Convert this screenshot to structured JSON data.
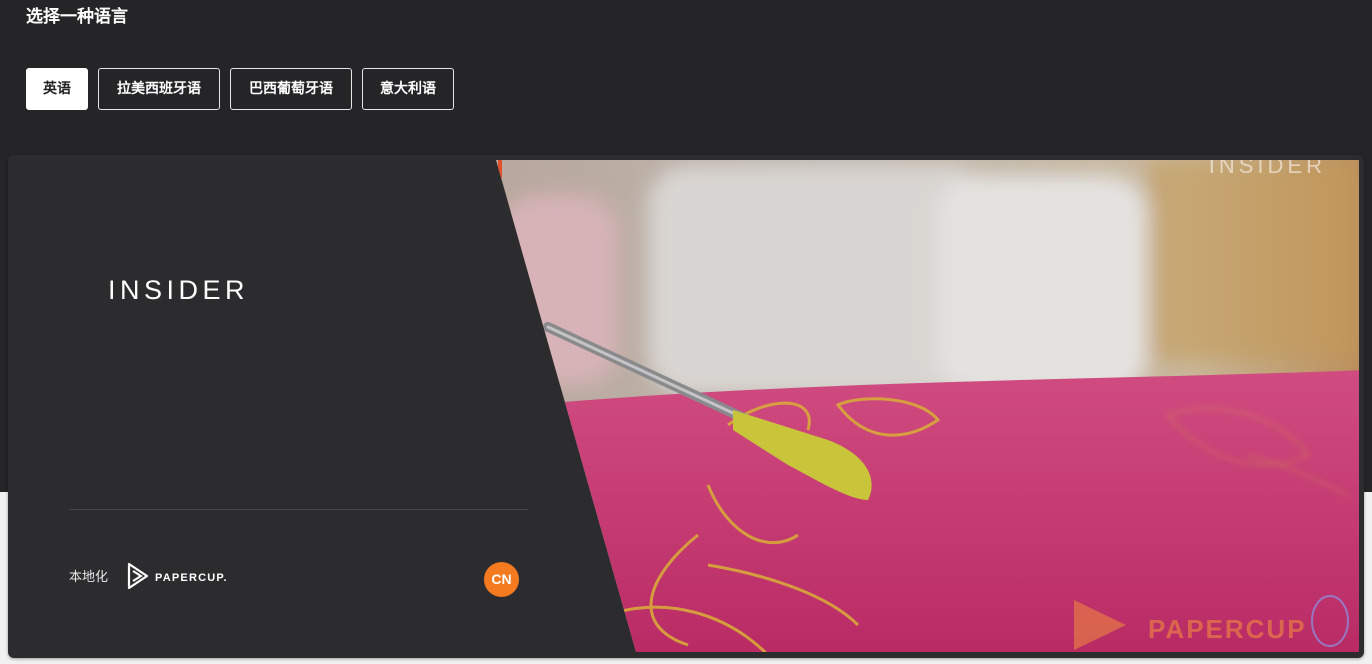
{
  "section": {
    "title": "选择一种语言"
  },
  "language_tabs": [
    {
      "label": "英语",
      "active": true
    },
    {
      "label": "拉美西班牙语",
      "active": false
    },
    {
      "label": "巴西葡萄牙语",
      "active": false
    },
    {
      "label": "意大利语",
      "active": false
    }
  ],
  "player": {
    "brand_logo": "INSIDER",
    "video_watermark": "INSIDER",
    "localized_by_label": "本地化",
    "partner_logo": "PAPERCUP.",
    "video_partner_watermark": "PAPERCUP",
    "language_badge": "CN",
    "colors": {
      "badge": "#f47a1f",
      "panel": "#2c2c2e",
      "fabric": "#c8356f",
      "embroidery": "#d9a93a"
    }
  }
}
